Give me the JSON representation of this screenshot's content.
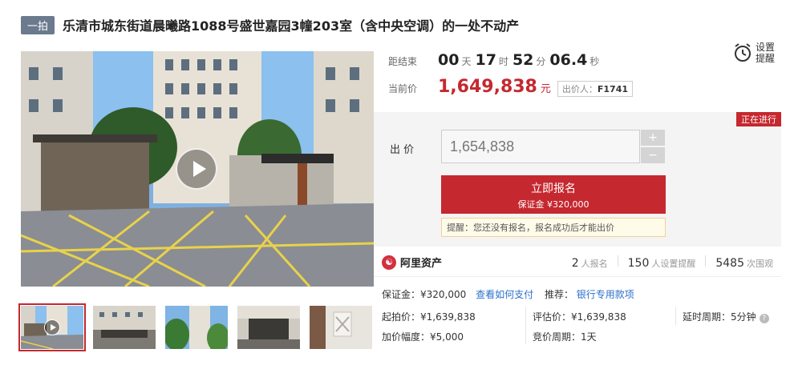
{
  "header": {
    "badge": "一拍",
    "title": "乐清市城东街道晨曦路1088号盛世嘉园3幢203室（含中央空调）的一处不动产"
  },
  "countdown": {
    "label": "距结束",
    "days": "00",
    "days_unit": "天",
    "hours": "17",
    "hours_unit": "时",
    "minutes": "52",
    "minutes_unit": "分",
    "seconds": "06.4",
    "seconds_unit": "秒"
  },
  "reminder": {
    "label": "设置提醒"
  },
  "current_price": {
    "label": "当前价",
    "value": "1,649,838",
    "unit": "元",
    "bidder_label": "出价人：",
    "bidder_id": "F1741"
  },
  "bid": {
    "status": "正在进行",
    "label": "出 价",
    "input_value": "1,654,838",
    "plus": "+",
    "minus": "−",
    "signup_label": "立即报名",
    "deposit_line": "保证金 ¥320,000",
    "notice": "提醒：您还没有报名，报名成功后才能出价"
  },
  "stats": {
    "platform": "阿里资产",
    "signups": "2",
    "signups_label": "人报名",
    "reminders": "150",
    "reminders_label": "人设置提醒",
    "views": "5485",
    "views_label": "次围观"
  },
  "details": {
    "deposit": "保证金：¥320,000",
    "how_to_pay": "查看如何支付",
    "recommend_label": "推荐：",
    "recommend_link": "银行专用款项",
    "start_price": "起拍价：¥1,639,838",
    "appraisal": "评估价：¥1,639,838",
    "delay": "延时周期：5分钟",
    "increment": "加价幅度：¥5,000",
    "bid_cycle": "竞价周期：1天"
  },
  "colors": {
    "accent": "#c5282f",
    "link": "#2a6fc9",
    "badge": "#6b7a8d"
  },
  "icons": [
    "alarm-clock-icon",
    "play-icon",
    "help-icon",
    "ali-logo-icon"
  ]
}
